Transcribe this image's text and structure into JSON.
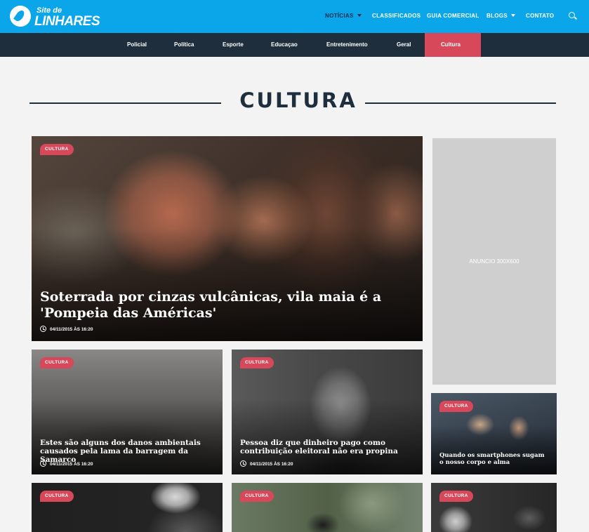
{
  "site": {
    "logo_small": "Site de",
    "logo_big": "LINHARES"
  },
  "topnav": {
    "noticias": "NOTÍCIAS",
    "classificados": "CLASSIFICADOS",
    "guia": "GUIA COMERCIAL",
    "blogs": "BLOGS",
    "contato": "CONTATO",
    "search_icon": "search-icon",
    "active_color": "#0f2c4c"
  },
  "categories": {
    "policial": "Policial",
    "politica": "Política",
    "esporte": "Esporte",
    "educacao": "Educaçao",
    "entretenimento": "Entretenimento",
    "geral": "Geral",
    "cultura": "Cultura",
    "active": "Cultura",
    "active_color": "#d6485a"
  },
  "section": {
    "title": "CULTURA"
  },
  "colors": {
    "header_blue": "#0aa6e9",
    "dark_navy": "#1e2e3d",
    "accent_red": "#d6485a",
    "page_bg": "#f3f3f3"
  },
  "hero": {
    "badge": "CULTURA",
    "headline": "Soterrada por cinzas vulcânicas, vila maia é a 'Pompeia das Américas'",
    "date": "04/11/2015 ÀS 16:20"
  },
  "cards": [
    {
      "badge": "CULTURA",
      "headline": "Estes são alguns dos danos ambientais causados pela lama da barragem da Samarco",
      "date": "04/11/2015 ÀS 16:20"
    },
    {
      "badge": "CULTURA",
      "headline": "Pessoa diz que dinheiro pago como contribuição eleitoral não era propina",
      "date": "04/11/2015 ÀS 16:20"
    },
    {
      "badge": "CULTURA",
      "headline": "Quando os smartphones sugam o nosso corpo e alma"
    },
    {
      "badge": "CULTURA"
    },
    {
      "badge": "CULTURA"
    },
    {
      "badge": "CULTURA"
    }
  ],
  "ad": {
    "label": "ANUNCIO 300X600"
  }
}
